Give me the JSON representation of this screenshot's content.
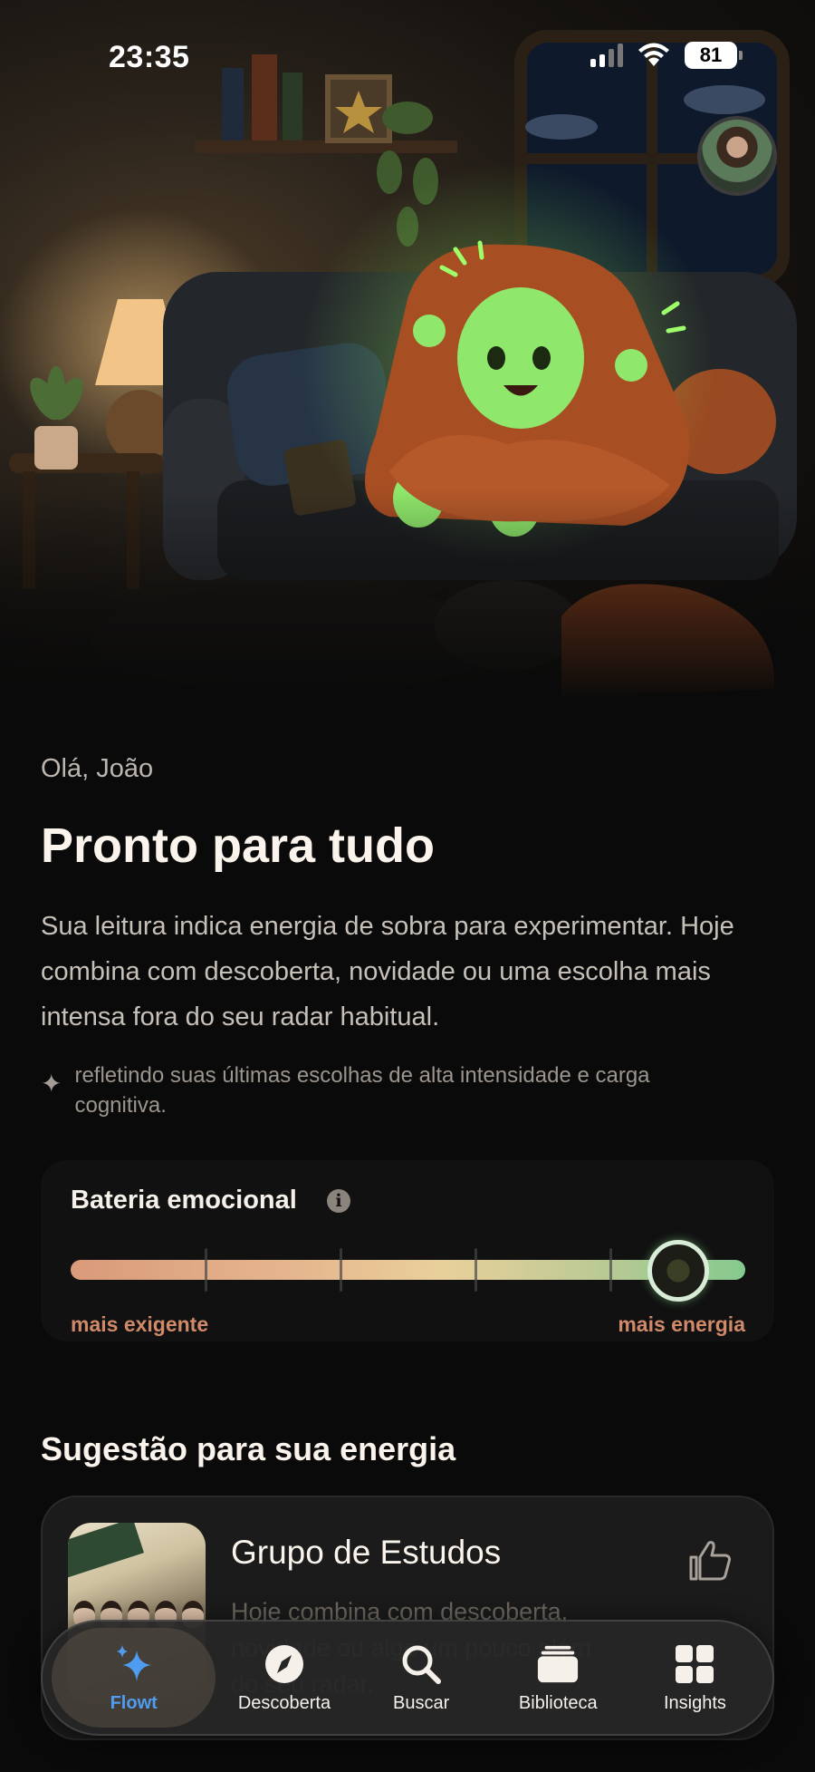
{
  "status_bar": {
    "time": "23:35",
    "battery": "81"
  },
  "greeting": "Olá, João",
  "mood": {
    "title": "Pronto para tudo",
    "description": "Sua leitura indica energia de sobra para experimentar. Hoje combina com descoberta, novidade ou uma escolha mais intensa fora do seu radar habitual.",
    "insight_icon": "sparkle-icon",
    "insight": "refletindo suas últimas escolhas de alta intensidade e carga cognitiva."
  },
  "emotional_battery": {
    "title": "Bateria emocional",
    "info_icon": "i",
    "min_label": "mais exigente",
    "max_label": "mais energia",
    "level": 0.9,
    "ticks": 4
  },
  "suggestion": {
    "section_title": "Sugestão para sua energia",
    "title": "Grupo de Estudos",
    "subtitle": "Hoje combina com descoberta, novidade ou algo um pouco além do seu radar."
  },
  "tabs": [
    {
      "label": "Flowt",
      "icon": "sparkles-icon",
      "active": true
    },
    {
      "label": "Descoberta",
      "icon": "compass-icon",
      "active": false
    },
    {
      "label": "Buscar",
      "icon": "search-icon",
      "active": false
    },
    {
      "label": "Biblioteca",
      "icon": "library-icon",
      "active": false
    },
    {
      "label": "Insights",
      "icon": "grid-icon",
      "active": false
    }
  ],
  "colors": {
    "accent": "#4f9cf0",
    "gradient_start": "#d99a7a",
    "gradient_end": "#86c98f",
    "glow": "#7be05a"
  }
}
